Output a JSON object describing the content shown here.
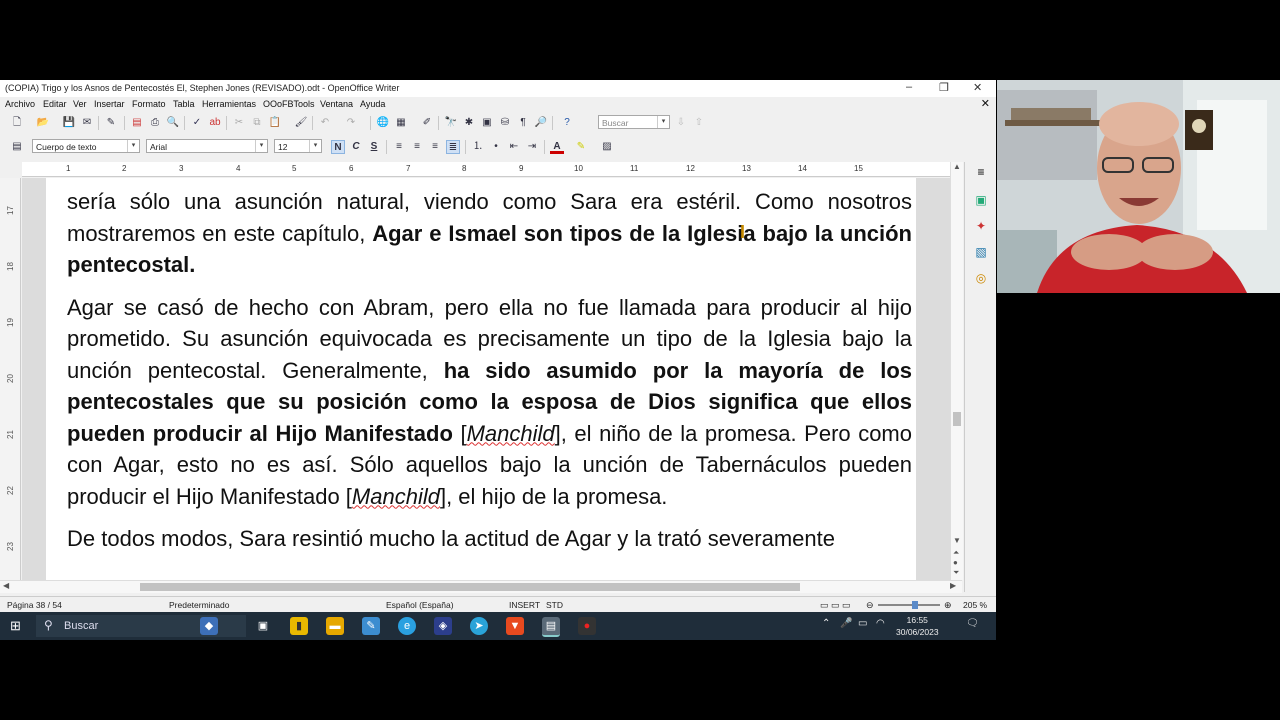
{
  "window": {
    "title": "(COPIA) Trigo y los Asnos de Pentecostés El, Stephen Jones (REVISADO).odt - OpenOffice Writer",
    "controls": [
      "–",
      "❐",
      "✕"
    ]
  },
  "menu": [
    "Archivo",
    "Editar",
    "Ver",
    "Insertar",
    "Formato",
    "Tabla",
    "Herramientas",
    "OOoFBTools",
    "Ventana",
    "Ayuda"
  ],
  "toolbar": {
    "search_placeholder": "Buscar"
  },
  "format_bar": {
    "paragraph_style": "Cuerpo de texto",
    "font_name": "Arial",
    "font_size": "12",
    "bold": "N",
    "italic": "C",
    "underline": "S"
  },
  "ruler": {
    "numbers": [
      "1",
      "2",
      "3",
      "4",
      "5",
      "6",
      "7",
      "8",
      "9",
      "10",
      "11",
      "12",
      "13",
      "14",
      "15"
    ]
  },
  "vruler": {
    "numbers": [
      "17",
      "18",
      "19",
      "20",
      "21",
      "22",
      "23"
    ]
  },
  "document": {
    "p1_a": "sería sólo una asunción natural, viendo como Sara era estéril. Como nosotros mostraremos en este capítulo, ",
    "p1_b": "Agar e Ismael son tipos de la Iglesia bajo la unción pentecostal.",
    "p2_a": "Agar se casó de hecho con Abram, pero ella no fue llamada para producir al hijo prometido. Su asunción equivocada es precisamente un tipo de la Iglesia bajo la unción pentecostal. Generalmente, ",
    "p2_b": "ha sido asumido por la mayoría de los pentecostales que su posición como la esposa de Dios significa que ellos pueden producir al Hijo Manifestado",
    "p2_c": " [",
    "p2_d": "Manchild",
    "p2_e": "], el niño de la promesa. Pero como con Agar, esto no es así. Sólo aquellos bajo la unción de Tabernáculos pueden producir el Hijo Manifestado [",
    "p2_f": "Manchild",
    "p2_g": "], el hijo de la promesa.",
    "p3": "De todos modos, Sara resintió mucho la actitud de Agar y la trató severamente"
  },
  "status": {
    "page": "Página  38 / 54",
    "style": "Predeterminado",
    "language": "Español (España)",
    "mode": "INSERT",
    "selection": "STD",
    "zoom": "205 %",
    "zoom_level": 0.6
  },
  "taskbar": {
    "search": "Buscar",
    "time": "16:55",
    "date": "30/06/2023"
  }
}
